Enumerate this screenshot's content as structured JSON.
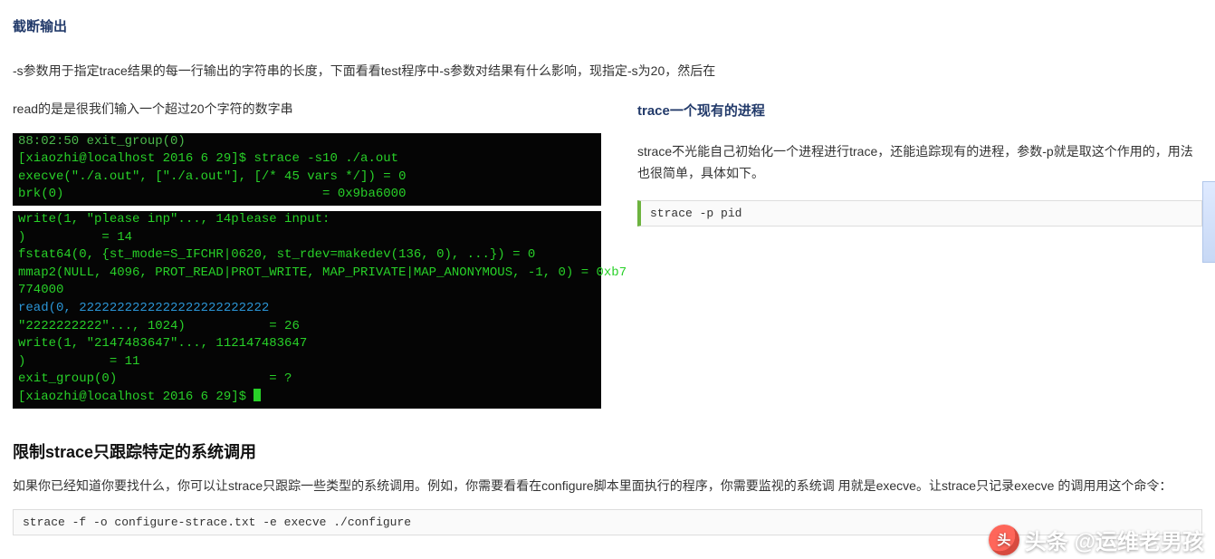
{
  "heading_truncate": "截断输出",
  "p_truncate1": "-s参数用于指定trace结果的每一行输出的字符串的长度，下面看看test程序中-s参数对结果有什么影响，现指定-s为20，然后在",
  "p_truncate2": "read的是是很我们输入一个超过20个字符的数字串",
  "terminal1_lines": [
    {
      "cls": "dim",
      "text": "88:02:50 exit_group(0)"
    },
    {
      "cls": "",
      "text": "[xiaozhi@localhost 2016 6 29]$ strace -s10 ./a.out"
    },
    {
      "cls": "",
      "text": "execve(\"./a.out\", [\"./a.out\"], [/* 45 vars */]) = 0"
    },
    {
      "cls": "",
      "text": "brk(0)                                  = 0x9ba6000"
    }
  ],
  "terminal2_lines": [
    {
      "cls": "",
      "text": "write(1, \"please inp\"..., 14please input:"
    },
    {
      "cls": "",
      "text": ")          = 14"
    },
    {
      "cls": "",
      "text": "fstat64(0, {st_mode=S_IFCHR|0620, st_rdev=makedev(136, 0), ...}) = 0"
    },
    {
      "cls": "",
      "text": "mmap2(NULL, 4096, PROT_READ|PROT_WRITE, MAP_PRIVATE|MAP_ANONYMOUS, -1, 0) = 0xb7"
    },
    {
      "cls": "",
      "text": "774000"
    },
    {
      "cls": "blue",
      "text": "read(0, 2222222222222222222222222"
    },
    {
      "cls": "",
      "text": "\"2222222222\"..., 1024)           = 26"
    },
    {
      "cls": "",
      "text": "write(1, \"2147483647\"..., 112147483647"
    },
    {
      "cls": "",
      "text": ")           = 11"
    },
    {
      "cls": "",
      "text": "exit_group(0)                    = ?"
    },
    {
      "cls": "prompt",
      "text": "[xiaozhi@localhost 2016 6 29]$ "
    }
  ],
  "right_heading": "trace一个现有的进程",
  "right_p": "strace不光能自己初始化一个进程进行trace，还能追踪现有的进程，参数-p就是取这个作用的，用法也很简单，具体如下。",
  "right_code": "strace -p pid",
  "sec2_heading": "限制strace只跟踪特定的系统调用",
  "sec2_p": "如果你已经知道你要找什么，你可以让strace只跟踪一些类型的系统调用。例如，你需要看看在configure脚本里面执行的程序，你需要监视的系统调 用就是execve。让strace只记录execve 的调用用这个命令：",
  "sec2_code": "strace -f -o configure-strace.txt -e execve ./configure",
  "watermark_logo": "头",
  "watermark_text": "头条 @运维老男孩"
}
